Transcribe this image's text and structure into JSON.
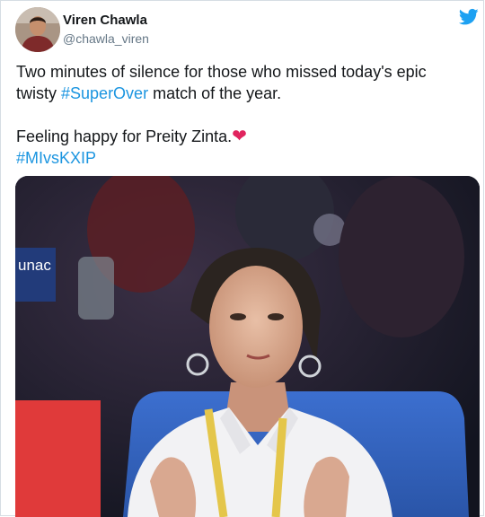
{
  "tweet": {
    "author_name": "Viren Chawla",
    "author_handle": "@chawla_viren",
    "text_line1": "Two minutes of silence for those who missed today's epic",
    "text_line2_prefix": "twisty ",
    "hashtag_superover": "#SuperOver",
    "text_line2_suffix": " match of the year.",
    "text_line3": "Feeling happy for Preity Zinta.",
    "heart_emoji": "❤",
    "hashtag_mivskxip": "#MIvsKXIP"
  },
  "media": {
    "banner_text": "unac"
  },
  "icons": {
    "avatar": "user-avatar",
    "logo": "twitter-bird-icon"
  },
  "colors": {
    "link": "#1b95e0",
    "twitter_blue": "#1da1f2",
    "heart": "#e0245e",
    "name": "#14171a",
    "handle": "#657786"
  }
}
